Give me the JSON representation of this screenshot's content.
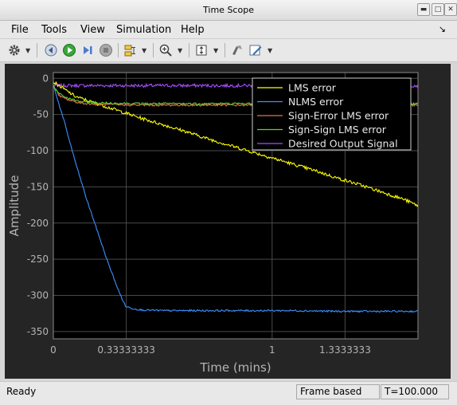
{
  "window": {
    "title": "Time Scope"
  },
  "menu": {
    "items": [
      "File",
      "Tools",
      "View",
      "Simulation",
      "Help"
    ]
  },
  "toolbar": {
    "icons": [
      "gear-icon",
      "step-back-icon",
      "run-icon",
      "step-forward-icon",
      "stop-icon",
      "signal-select-icon",
      "zoom-in-icon",
      "scale-axes-icon",
      "highlight-icon",
      "style-icon"
    ]
  },
  "status": {
    "ready": "Ready",
    "mode": "Frame based",
    "time": "T=100.000"
  },
  "chart_data": {
    "type": "line",
    "xlabel": "Time (mins)",
    "ylabel": "Amplitude",
    "xlim": [
      0,
      1.6667
    ],
    "ylim": [
      -360,
      8
    ],
    "x_ticks": [
      0,
      0.33333333,
      1,
      1.3333333
    ],
    "x_tick_labels": [
      "0",
      "0.33333333",
      "1",
      "1.3333333"
    ],
    "y_ticks": [
      0,
      -50,
      -100,
      -150,
      -200,
      -250,
      -300,
      -350
    ],
    "y_tick_labels": [
      "0",
      "-50",
      "-100",
      "-150",
      "-200",
      "-250",
      "-300",
      "-350"
    ],
    "grid": true,
    "legend_position": "top-right",
    "colors": {
      "background": "#000000",
      "figure": "#252526",
      "axis_text": "#b4b4b4",
      "grid": "#4a4a4a"
    },
    "series": [
      {
        "name": "LMS error",
        "color": "#ffff00",
        "x": [
          0,
          0.05,
          0.1,
          0.2,
          0.3,
          0.4,
          0.5,
          0.6,
          0.7,
          0.8,
          0.9,
          1.0,
          1.1,
          1.2,
          1.3,
          1.4,
          1.5,
          1.6,
          1.6667
        ],
        "y": [
          -5,
          -15,
          -25,
          -35,
          -45,
          -55,
          -64,
          -73,
          -83,
          -92,
          -101,
          -110,
          -119,
          -128,
          -138,
          -147,
          -157,
          -167,
          -176
        ]
      },
      {
        "name": "NLMS error",
        "color": "#3c8fff",
        "x": [
          0,
          0.02,
          0.05,
          0.1,
          0.15,
          0.2,
          0.25,
          0.3,
          0.33,
          0.36,
          0.4,
          0.5,
          0.7,
          0.9,
          1.1,
          1.3,
          1.5,
          1.6667
        ],
        "y": [
          -8,
          -30,
          -60,
          -115,
          -165,
          -210,
          -255,
          -295,
          -315,
          -318,
          -320,
          -321,
          -321,
          -321,
          -321,
          -322,
          -322,
          -322
        ]
      },
      {
        "name": "Sign-Error LMS error",
        "color": "#e8704a",
        "x": [
          0,
          0.03,
          0.07,
          0.12,
          0.2,
          0.4,
          0.7,
          1.0,
          1.3,
          1.6667
        ],
        "y": [
          -10,
          -25,
          -30,
          -34,
          -36,
          -37,
          -37,
          -37,
          -37,
          -37
        ]
      },
      {
        "name": "Sign-Sign LMS error",
        "color": "#5ad535",
        "x": [
          0,
          0.03,
          0.07,
          0.12,
          0.2,
          0.4,
          0.7,
          1.0,
          1.3,
          1.6667
        ],
        "y": [
          -12,
          -22,
          -28,
          -32,
          -34,
          -35,
          -35,
          -35,
          -35,
          -35
        ]
      },
      {
        "name": "Desired Output Signal",
        "color": "#a64dff",
        "x": [
          0,
          0.4,
          0.8,
          1.2,
          1.6667
        ],
        "y": [
          -10,
          -10,
          -10,
          -10,
          -10
        ]
      }
    ]
  }
}
